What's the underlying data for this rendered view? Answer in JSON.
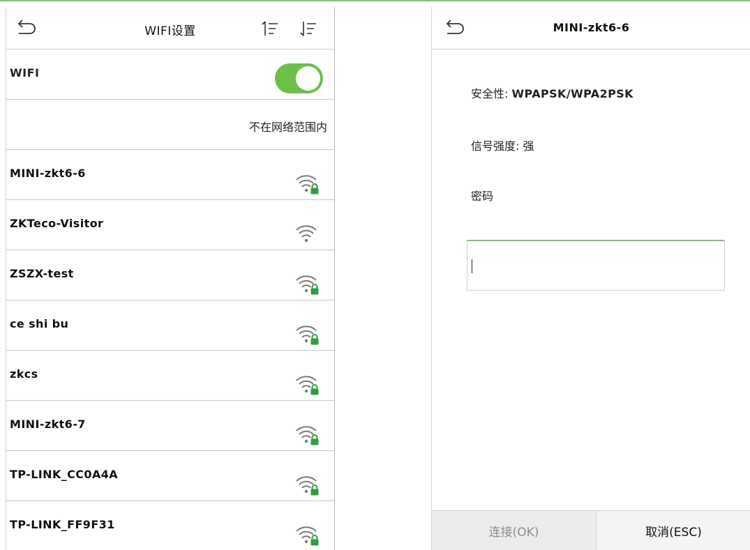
{
  "left": {
    "header": {
      "title": "WIFI设置"
    },
    "wifi_toggle": {
      "label": "WIFI",
      "state": "on",
      "color": "#6cc04a"
    },
    "status": "不在网络范围内",
    "networks": [
      {
        "name": "MINI-zkt6-6",
        "locked": true
      },
      {
        "name": "ZKTeco-Visitor",
        "locked": false
      },
      {
        "name": "ZSZX-test",
        "locked": true
      },
      {
        "name": "ce shi bu",
        "locked": true
      },
      {
        "name": "zkcs",
        "locked": true
      },
      {
        "name": "MINI-zkt6-7",
        "locked": true
      },
      {
        "name": "TP-LINK_CC0A4A",
        "locked": true
      },
      {
        "name": "TP-LINK_FF9F31",
        "locked": true
      }
    ]
  },
  "right": {
    "header": {
      "title": "MINI-zkt6-6"
    },
    "security": {
      "label": "安全性:",
      "value": "WPAPSK/WPA2PSK"
    },
    "signal": {
      "label": "信号强度:",
      "value": "强"
    },
    "password": {
      "label": "密码",
      "value": ""
    },
    "buttons": {
      "ok": "连接(OK)",
      "cancel": "取消(ESC)"
    }
  },
  "colors": {
    "accent": "#6cc04a",
    "lock": "#2e9e43",
    "input_focus": "#7cc576"
  },
  "icons": [
    "back-arrow-icon",
    "sort-ascending-icon",
    "sort-descending-icon",
    "wifi-lock-icon",
    "wifi-icon"
  ]
}
